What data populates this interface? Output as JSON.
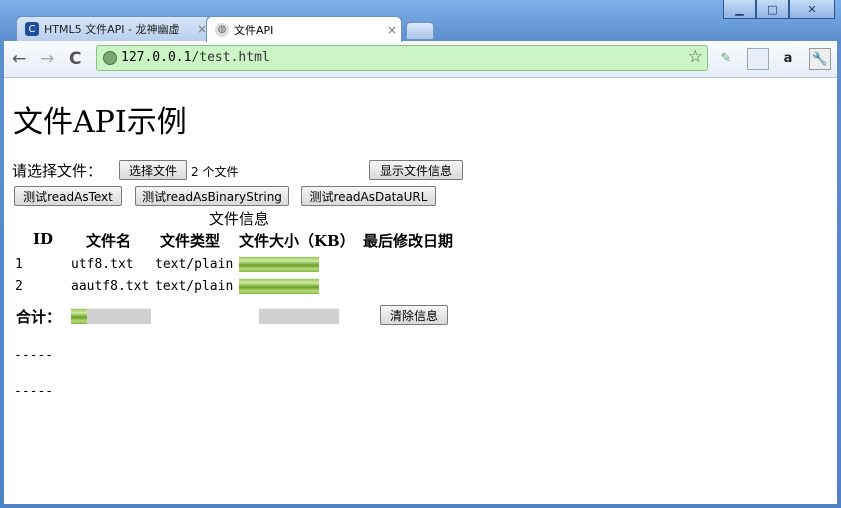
{
  "window": {
    "controls": {
      "minimize": "▁",
      "maximize": "□",
      "close": "✕"
    }
  },
  "tabs": [
    {
      "title": "HTML5 文件API - 龙神幽虚",
      "close": "×",
      "icon": "blogger-c-icon"
    },
    {
      "title": "文件API",
      "close": "×",
      "icon": "globe-icon"
    }
  ],
  "toolbar": {
    "back": "←",
    "forward": "→",
    "reload": "C",
    "url_host": "127.0.0.1",
    "url_path": "/test.html",
    "star": "☆"
  },
  "page": {
    "title": "文件API示例",
    "choose_label": "请选择文件：",
    "choose_button": "选择文件",
    "file_count": "2 个文件",
    "show_info_button": "显示文件信息",
    "test_buttons": [
      "测试readAsText",
      "测试readAsBinaryString",
      "测试readAsDataURL"
    ],
    "table_caption": "文件信息",
    "headers": [
      "ID",
      "文件名",
      "文件类型",
      "文件大小（KB）",
      "最后修改日期"
    ],
    "rows": [
      {
        "id": "1",
        "name": "utf8.txt",
        "type": "text/plain",
        "progress": 1.0
      },
      {
        "id": "2",
        "name": "aautf8.txt",
        "type": "text/plain",
        "progress": 1.0
      }
    ],
    "total_label": "合计：",
    "total_progress": 0.2,
    "total_progress2": 0.0,
    "clear_button": "清除信息",
    "separator1": "-----",
    "separator2": "-----"
  },
  "colors": {
    "address_bar_bg": "#ccf5c6",
    "progress_green": "#7bb33a",
    "frame_blue": "#5d8fd0"
  }
}
